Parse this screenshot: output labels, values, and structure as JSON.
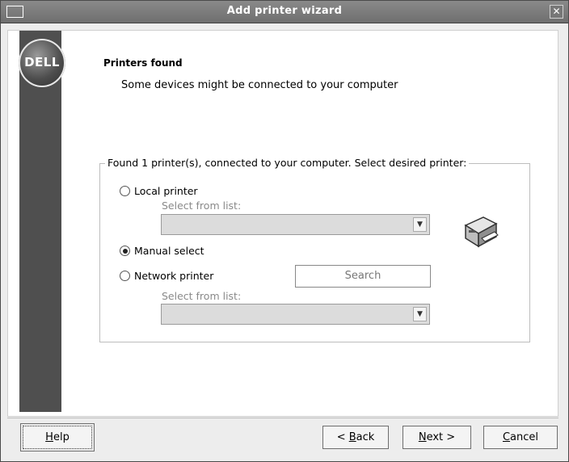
{
  "window": {
    "title": "Add printer wizard",
    "close_glyph": "✕"
  },
  "logo": {
    "text": "DELL"
  },
  "header": {
    "title": "Printers found",
    "subtitle": "Some devices might be connected to your computer"
  },
  "group": {
    "legend": "Found 1 printer(s), connected to your computer. Select desired printer:"
  },
  "options": {
    "local": {
      "label": "Local printer",
      "checked": false,
      "sublabel": "Select from list:",
      "value": ""
    },
    "manual": {
      "label": "Manual select",
      "checked": true
    },
    "network": {
      "label": "Network printer",
      "checked": false,
      "sublabel": "Select from list:",
      "value": ""
    }
  },
  "search_button": {
    "label": "Search"
  },
  "buttons": {
    "help": {
      "mnemonic": "H",
      "rest": "elp"
    },
    "back": {
      "prefix": "< ",
      "mnemonic": "B",
      "rest": "ack"
    },
    "next": {
      "mnemonic": "N",
      "rest": "ext >"
    },
    "cancel": {
      "mnemonic": "C",
      "rest": "ancel"
    }
  },
  "icons": [
    "window-menu-icon",
    "close-icon",
    "dell-logo",
    "printer-icon",
    "combo-arrow-icon"
  ]
}
